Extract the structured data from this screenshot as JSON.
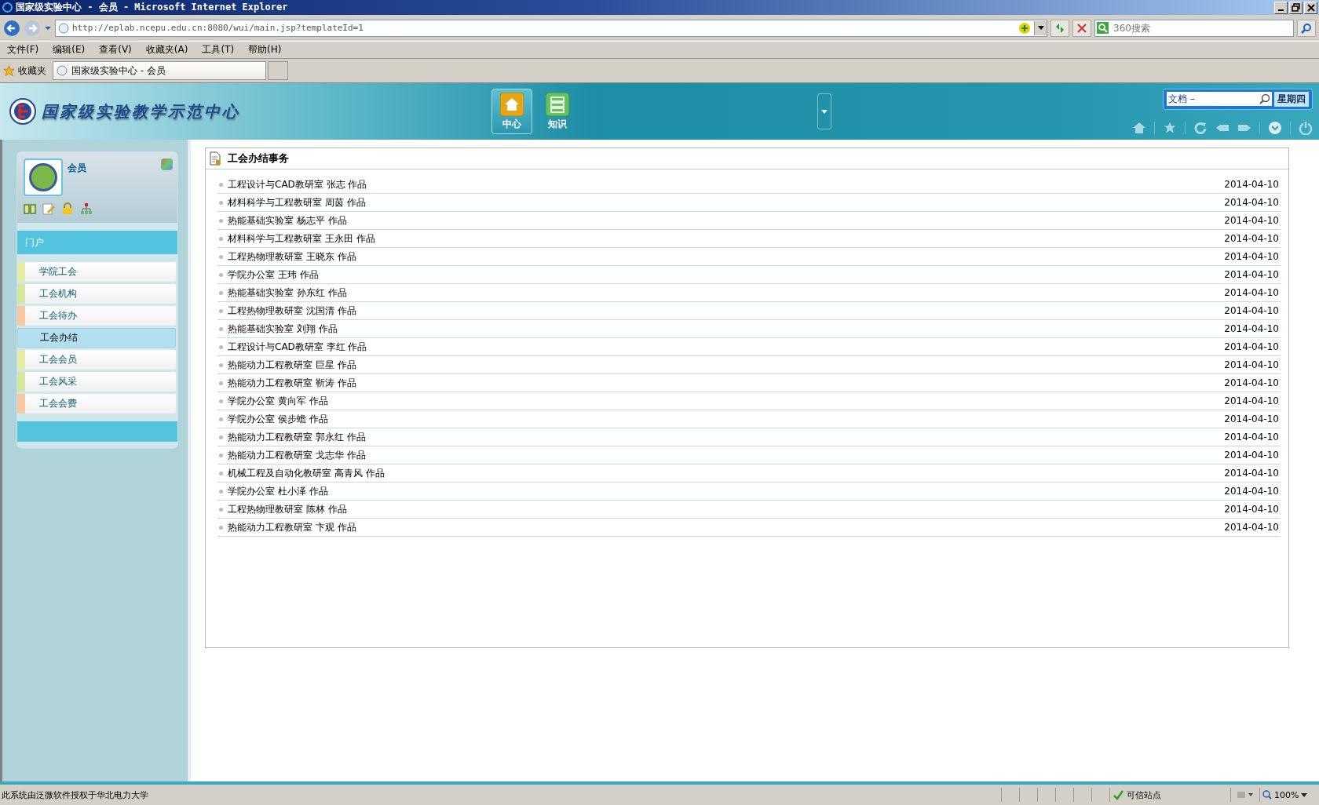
{
  "browser": {
    "title": "国家级实验中心 - 会员 - Microsoft Internet Explorer",
    "address": "http://eplab.ncepu.edu.cn:8080/wui/main.jsp?templateId=1",
    "search_placeholder": "360搜索",
    "menu": [
      "文件(F)",
      "编辑(E)",
      "查看(V)",
      "收藏夹(A)",
      "工具(T)",
      "帮助(H)"
    ],
    "favorites_label": "收藏夹",
    "tab_title": "国家级实验中心 - 会员"
  },
  "header": {
    "logo_text": "国家级实验教学示范中心",
    "nav": [
      {
        "label": "中心",
        "selected": true
      },
      {
        "label": "知识",
        "selected": false
      }
    ],
    "search_value": "文档 –",
    "weekday": "星期四"
  },
  "sidebar": {
    "user": "会员",
    "section": "门户",
    "items": [
      {
        "label": "学院工会",
        "color": "#e6eaa8",
        "selected": false
      },
      {
        "label": "工会机构",
        "color": "#d5e6a0",
        "selected": false
      },
      {
        "label": "工会待办",
        "color": "#f8c8a0",
        "selected": false
      },
      {
        "label": "工会办结",
        "color": "#b3dff0",
        "selected": true
      },
      {
        "label": "工会会员",
        "color": "#e6eaa8",
        "selected": false
      },
      {
        "label": "工会风采",
        "color": "#d5e6a0",
        "selected": false
      },
      {
        "label": "工会会费",
        "color": "#f8c8a0",
        "selected": false
      }
    ]
  },
  "content": {
    "title": "工会办结事务",
    "rows": [
      {
        "text": "工程设计与CAD教研室 张志 作品",
        "date": "2014-04-10"
      },
      {
        "text": "材料科学与工程教研室 周茵 作品",
        "date": "2014-04-10"
      },
      {
        "text": "热能基础实验室 杨志平 作品",
        "date": "2014-04-10"
      },
      {
        "text": "材料科学与工程教研室 王永田 作品",
        "date": "2014-04-10"
      },
      {
        "text": "工程热物理教研室 王晓东 作品",
        "date": "2014-04-10"
      },
      {
        "text": "学院办公室 王玮 作品",
        "date": "2014-04-10"
      },
      {
        "text": "热能基础实验室 孙东红 作品",
        "date": "2014-04-10"
      },
      {
        "text": "工程热物理教研室 沈国清 作品",
        "date": "2014-04-10"
      },
      {
        "text": "热能基础实验室 刘翔 作品",
        "date": "2014-04-10"
      },
      {
        "text": "工程设计与CAD教研室 李红 作品",
        "date": "2014-04-10"
      },
      {
        "text": "热能动力工程教研室 巨星 作品",
        "date": "2014-04-10"
      },
      {
        "text": "热能动力工程教研室 靳涛 作品",
        "date": "2014-04-10"
      },
      {
        "text": "学院办公室 黄向军 作品",
        "date": "2014-04-10"
      },
      {
        "text": "学院办公室 侯步蟾 作品",
        "date": "2014-04-10"
      },
      {
        "text": "热能动力工程教研室 郭永红 作品",
        "date": "2014-04-10"
      },
      {
        "text": "热能动力工程教研室 戈志华 作品",
        "date": "2014-04-10"
      },
      {
        "text": "机械工程及自动化教研室 高青风 作品",
        "date": "2014-04-10"
      },
      {
        "text": "学院办公室 杜小泽 作品",
        "date": "2014-04-10"
      },
      {
        "text": "工程热物理教研室 陈林 作品",
        "date": "2014-04-10"
      },
      {
        "text": "热能动力工程教研室 卞观 作品",
        "date": "2014-04-10"
      }
    ]
  },
  "status": {
    "text": "此系统由泛微软件授权于华北电力大学",
    "zone": "可信站点",
    "zoom": "100%"
  }
}
